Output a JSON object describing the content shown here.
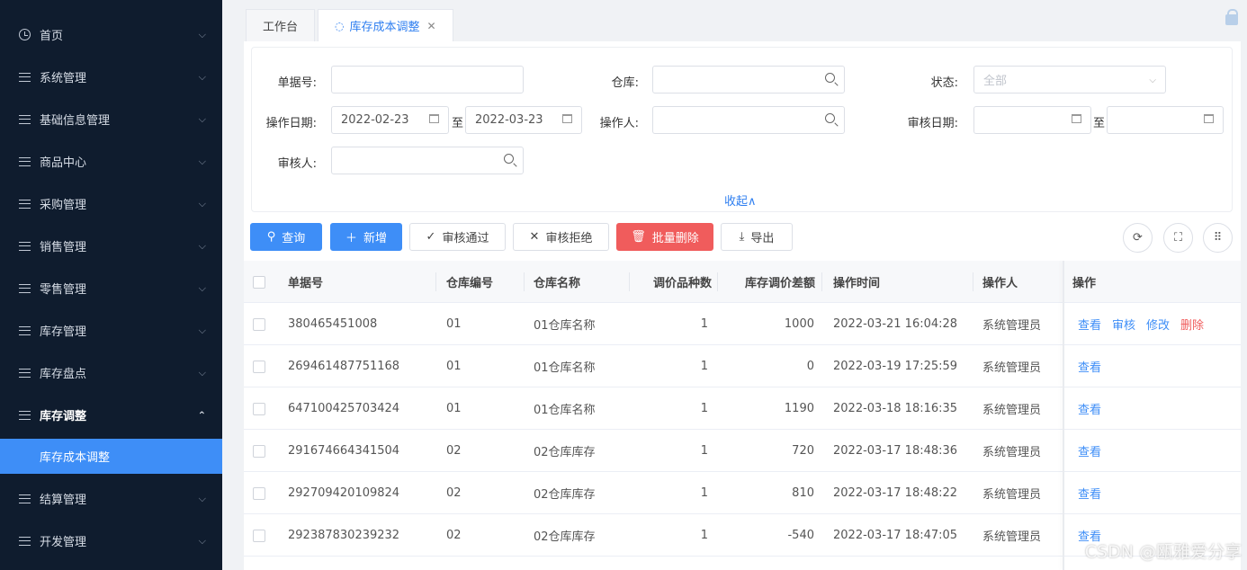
{
  "sidebar": {
    "items": [
      {
        "label": "首页",
        "icon": "clock-icon"
      },
      {
        "label": "系统管理",
        "icon": "menu-icon"
      },
      {
        "label": "基础信息管理",
        "icon": "menu-icon"
      },
      {
        "label": "商品中心",
        "icon": "menu-icon"
      },
      {
        "label": "采购管理",
        "icon": "menu-icon"
      },
      {
        "label": "销售管理",
        "icon": "menu-icon"
      },
      {
        "label": "零售管理",
        "icon": "menu-icon"
      },
      {
        "label": "库存管理",
        "icon": "menu-icon"
      },
      {
        "label": "库存盘点",
        "icon": "menu-icon"
      },
      {
        "label": "库存调整",
        "icon": "menu-icon",
        "expanded": true
      },
      {
        "label": "库存成本调整",
        "active": true
      },
      {
        "label": "结算管理",
        "icon": "menu-icon"
      },
      {
        "label": "开发管理",
        "icon": "menu-icon"
      }
    ]
  },
  "tabs": [
    {
      "label": "工作台"
    },
    {
      "label": "库存成本调整",
      "active": true
    }
  ],
  "filter": {
    "doc_no_label": "单据号:",
    "doc_no_value": "",
    "warehouse_label": "仓库:",
    "warehouse_value": "",
    "status_label": "状态:",
    "status_value": "全部",
    "op_date_label": "操作日期:",
    "op_date_start": "2022-02-23",
    "op_date_end": "2022-03-23",
    "range_to": "至",
    "operator_label": "操作人:",
    "operator_value": "",
    "audit_date_label": "审核日期:",
    "audit_date_start": "",
    "audit_date_end": "",
    "auditor_label": "审核人:",
    "auditor_value": "",
    "collapse_label": "收起∧"
  },
  "toolbar": {
    "query": "查询",
    "add": "新增",
    "approve": "审核通过",
    "reject": "审核拒绝",
    "batch_delete": "批量删除",
    "export": "导出"
  },
  "table": {
    "columns": [
      "单据号",
      "仓库编号",
      "仓库名称",
      "调价品种数",
      "库存调价差额",
      "操作时间",
      "操作人",
      "操作"
    ],
    "rows": [
      {
        "doc_no": "380465451008",
        "wh_code": "01",
        "wh_name": "01仓库名称",
        "count": "1",
        "diff": "1000",
        "time": "2022-03-21 16:04:28",
        "operator": "系统管理员",
        "actions": [
          "查看",
          "审核",
          "修改",
          "删除"
        ]
      },
      {
        "doc_no": "269461487751168",
        "wh_code": "01",
        "wh_name": "01仓库名称",
        "count": "1",
        "diff": "0",
        "time": "2022-03-19 17:25:59",
        "operator": "系统管理员",
        "actions": [
          "查看"
        ]
      },
      {
        "doc_no": "647100425703424",
        "wh_code": "01",
        "wh_name": "01仓库名称",
        "count": "1",
        "diff": "1190",
        "time": "2022-03-18 18:16:35",
        "operator": "系统管理员",
        "actions": [
          "查看"
        ]
      },
      {
        "doc_no": "291674664341504",
        "wh_code": "02",
        "wh_name": "02仓库库存",
        "count": "1",
        "diff": "720",
        "time": "2022-03-17 18:48:36",
        "operator": "系统管理员",
        "actions": [
          "查看"
        ]
      },
      {
        "doc_no": "292709420109824",
        "wh_code": "02",
        "wh_name": "02仓库库存",
        "count": "1",
        "diff": "810",
        "time": "2022-03-17 18:48:22",
        "operator": "系统管理员",
        "actions": [
          "查看"
        ]
      },
      {
        "doc_no": "292387830239232",
        "wh_code": "02",
        "wh_name": "02仓库库存",
        "count": "1",
        "diff": "-540",
        "time": "2022-03-17 18:47:05",
        "operator": "系统管理员",
        "actions": [
          "查看"
        ]
      }
    ]
  },
  "watermark": "CSDN @瓯雅爱分享",
  "colors": {
    "sidebar_bg": "#0f1c2e",
    "accent": "#3e8ef7",
    "danger": "#f05c5c"
  }
}
